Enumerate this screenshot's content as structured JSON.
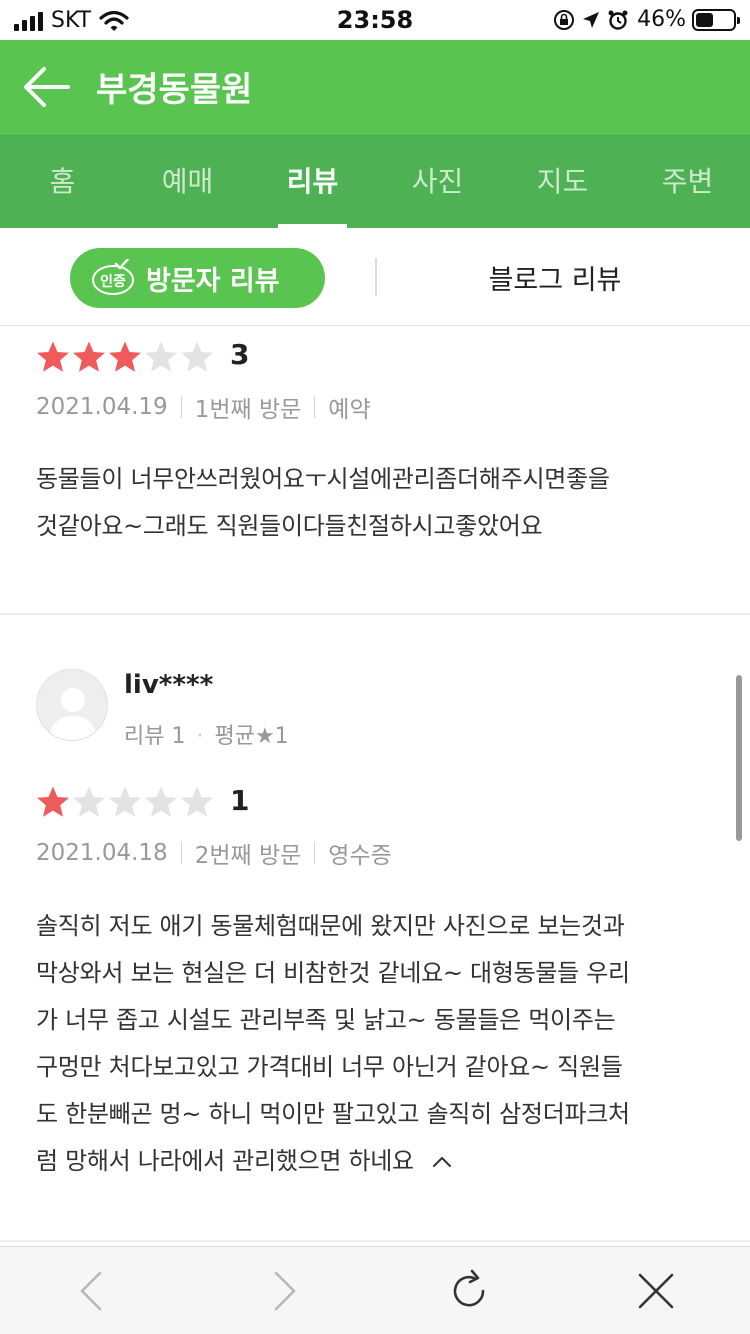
{
  "status_bar": {
    "carrier": "SKT",
    "time": "23:58",
    "battery_percent": "46%",
    "battery_level": 0.46,
    "icons": [
      "signal-icon",
      "wifi-icon",
      "orientation-lock-icon",
      "location-icon",
      "alarm-icon",
      "battery-icon"
    ]
  },
  "header": {
    "title": "부경동물원",
    "back_icon": "arrow-left-icon"
  },
  "tabs": [
    {
      "label": "홈",
      "active": false
    },
    {
      "label": "예매",
      "active": false
    },
    {
      "label": "리뷰",
      "active": true
    },
    {
      "label": "사진",
      "active": false
    },
    {
      "label": "지도",
      "active": false
    },
    {
      "label": "주변",
      "active": false
    }
  ],
  "review_switcher": {
    "badge_text": "인증",
    "visitor_label": "방문자 리뷰",
    "blog_label": "블로그 리뷰",
    "selected": "방문자 리뷰"
  },
  "reviews": [
    {
      "rating": 3,
      "rating_text": "3",
      "date": "2021.04.19",
      "visit": "1번째 방문",
      "tag": "예약",
      "text_lines": [
        "동물들이 너무안쓰러웠어요ㅜ시설에관리좀더해주시면좋을",
        "것같아요~그래도 직원들이다들친절하시고좋았어요"
      ]
    },
    {
      "user": "liv****",
      "review_count": "리뷰 1",
      "average": "평균★1",
      "rating": 1,
      "rating_text": "1",
      "date": "2021.04.18",
      "visit": "2번째 방문",
      "tag": "영수증",
      "text_lines": [
        "솔직히 저도 애기 동물체험때문에 왔지만 사진으로 보는것과",
        "막상와서 보는 현실은 더 비참한것 같네요~ 대형동물들 우리",
        "가 너무 좁고 시설도 관리부족 및 낡고~ 동물들은 먹이주는",
        "구멍만 처다보고있고 가격대비 너무 아닌거 같아요~ 직원들",
        "도 한분빼곤 멍~ 하니 먹이만 팔고있고 솔직히 삼정더파크처",
        "럼 망해서 나라에서 관리했으면 하네요"
      ]
    }
  ],
  "colors": {
    "header_green": "#5ac451",
    "tab_green": "#4eb154",
    "star_red": "#ef5a5a",
    "star_gray": "#e3e3e6"
  },
  "toolbar": {
    "icons": [
      "back-icon",
      "forward-icon",
      "reload-icon",
      "close-icon"
    ]
  }
}
